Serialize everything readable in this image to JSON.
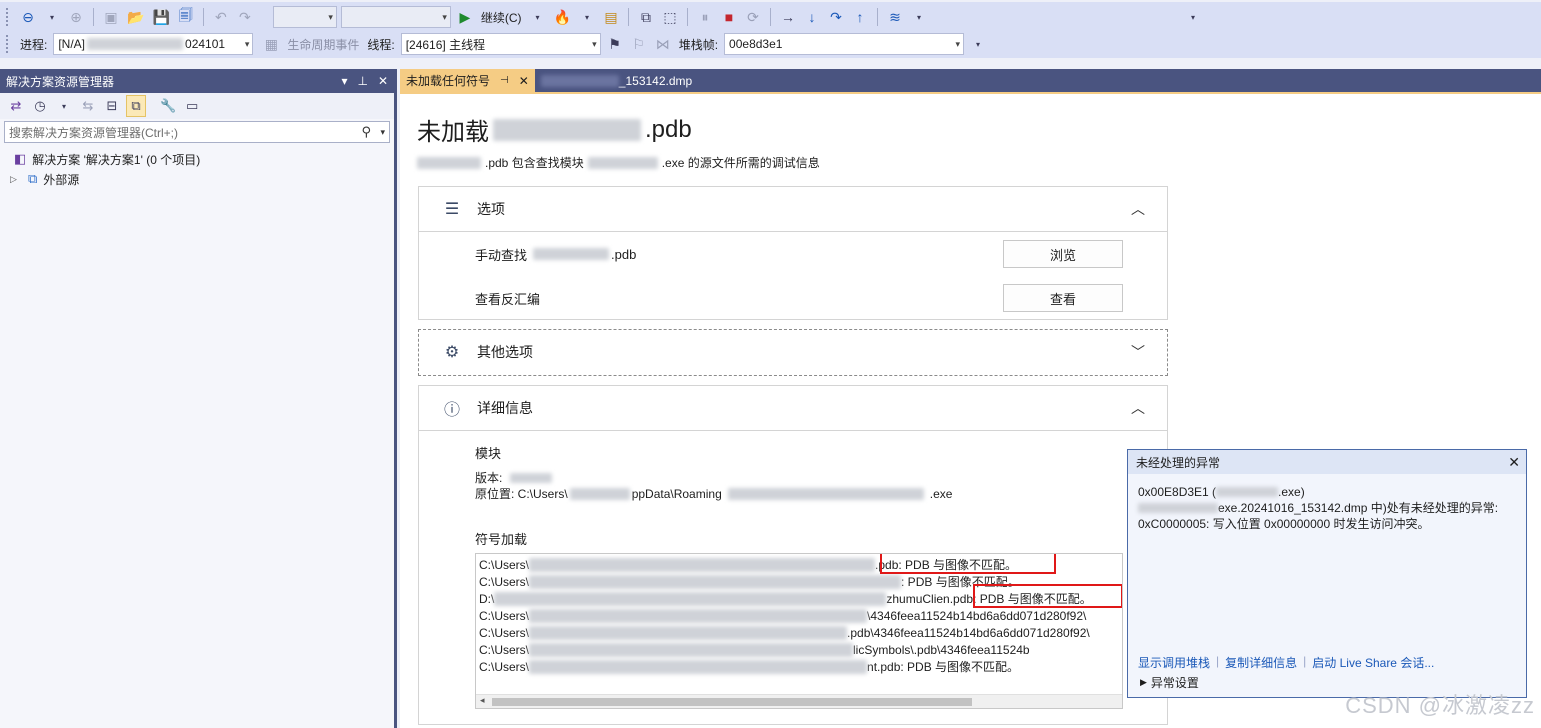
{
  "toolbar1": {
    "continue_label": "继续(C)"
  },
  "toolbar2": {
    "process_label": "进程:",
    "process_value_prefix": "[N/A]",
    "process_value_suffix": "024101",
    "lifecycle_label": "生命周期事件",
    "thread_label": "线程:",
    "thread_value": "[24616] 主线程",
    "stackframe_label": "堆栈帧:",
    "stackframe_value": "00e8d3e1"
  },
  "solution_explorer": {
    "title": "解决方案资源管理器",
    "search_placeholder": "搜索解决方案资源管理器(Ctrl+;)",
    "tree": [
      {
        "label": "解决方案 '解决方案1' (0 个项目)"
      },
      {
        "label": "外部源"
      }
    ]
  },
  "tabs": [
    {
      "label": "未加载任何符号"
    },
    {
      "label": "_153142.dmp"
    }
  ],
  "doc": {
    "title_prefix": "未加载",
    "title_suffix": ".pdb",
    "subtitle_a": ".pdb 包含查找模块",
    "subtitle_b": ".exe 的源文件所需的调试信息",
    "options": {
      "title": "选项",
      "manual_find_prefix": "手动查找",
      "manual_find_suffix": ".pdb",
      "browse_label": "浏览",
      "disasm_label": "查看反汇编",
      "view_label": "查看"
    },
    "other": {
      "title": "其他选项"
    },
    "details": {
      "title": "详细信息",
      "module_label": "模块",
      "version_label": "版本:",
      "location_prefix": "原位置: C:\\Users\\",
      "location_mid": "ppData\\Roaming",
      "location_suffix": ".exe",
      "symbol_label": "符号加载",
      "symbol_lines": [
        {
          "prefix": "C:\\Users\\",
          "suffix": ".pdb: PDB 与图像不匹配。"
        },
        {
          "prefix": "C:\\Users\\",
          "suffix": ": PDB 与图像不匹配。"
        },
        {
          "prefix": "D:\\",
          "suffix": "zhumuClien.pdb: PDB 与图像不匹配。"
        },
        {
          "prefix": "C:\\Users\\",
          "suffix": "\\4346feea11524b14bd6a6dd071d280f92\\"
        },
        {
          "prefix": "C:\\Users\\",
          "suffix": ".pdb\\4346feea11524b14bd6a6dd071d280f92\\"
        },
        {
          "prefix": "C:\\Users\\",
          "suffix": "licSymbols\\.pdb\\4346feea11524b"
        },
        {
          "prefix": "C:\\Users\\",
          "suffix": "nt.pdb: PDB 与图像不匹配。"
        }
      ]
    }
  },
  "exception": {
    "title": "未经处理的异常",
    "line1_prefix": "0x00E8D3E1 (",
    "line1_suffix": ".exe)",
    "line2": "exe.20241016_153142.dmp 中)处有未经处理的异常:",
    "line3": "0xC0000005: 写入位置 0x00000000 时发生访问冲突。",
    "links": [
      "显示调用堆栈",
      "复制详细信息",
      "启动 Live Share 会话..."
    ],
    "settings_label": "异常设置"
  },
  "watermark": "CSDN @冰激凌zz"
}
